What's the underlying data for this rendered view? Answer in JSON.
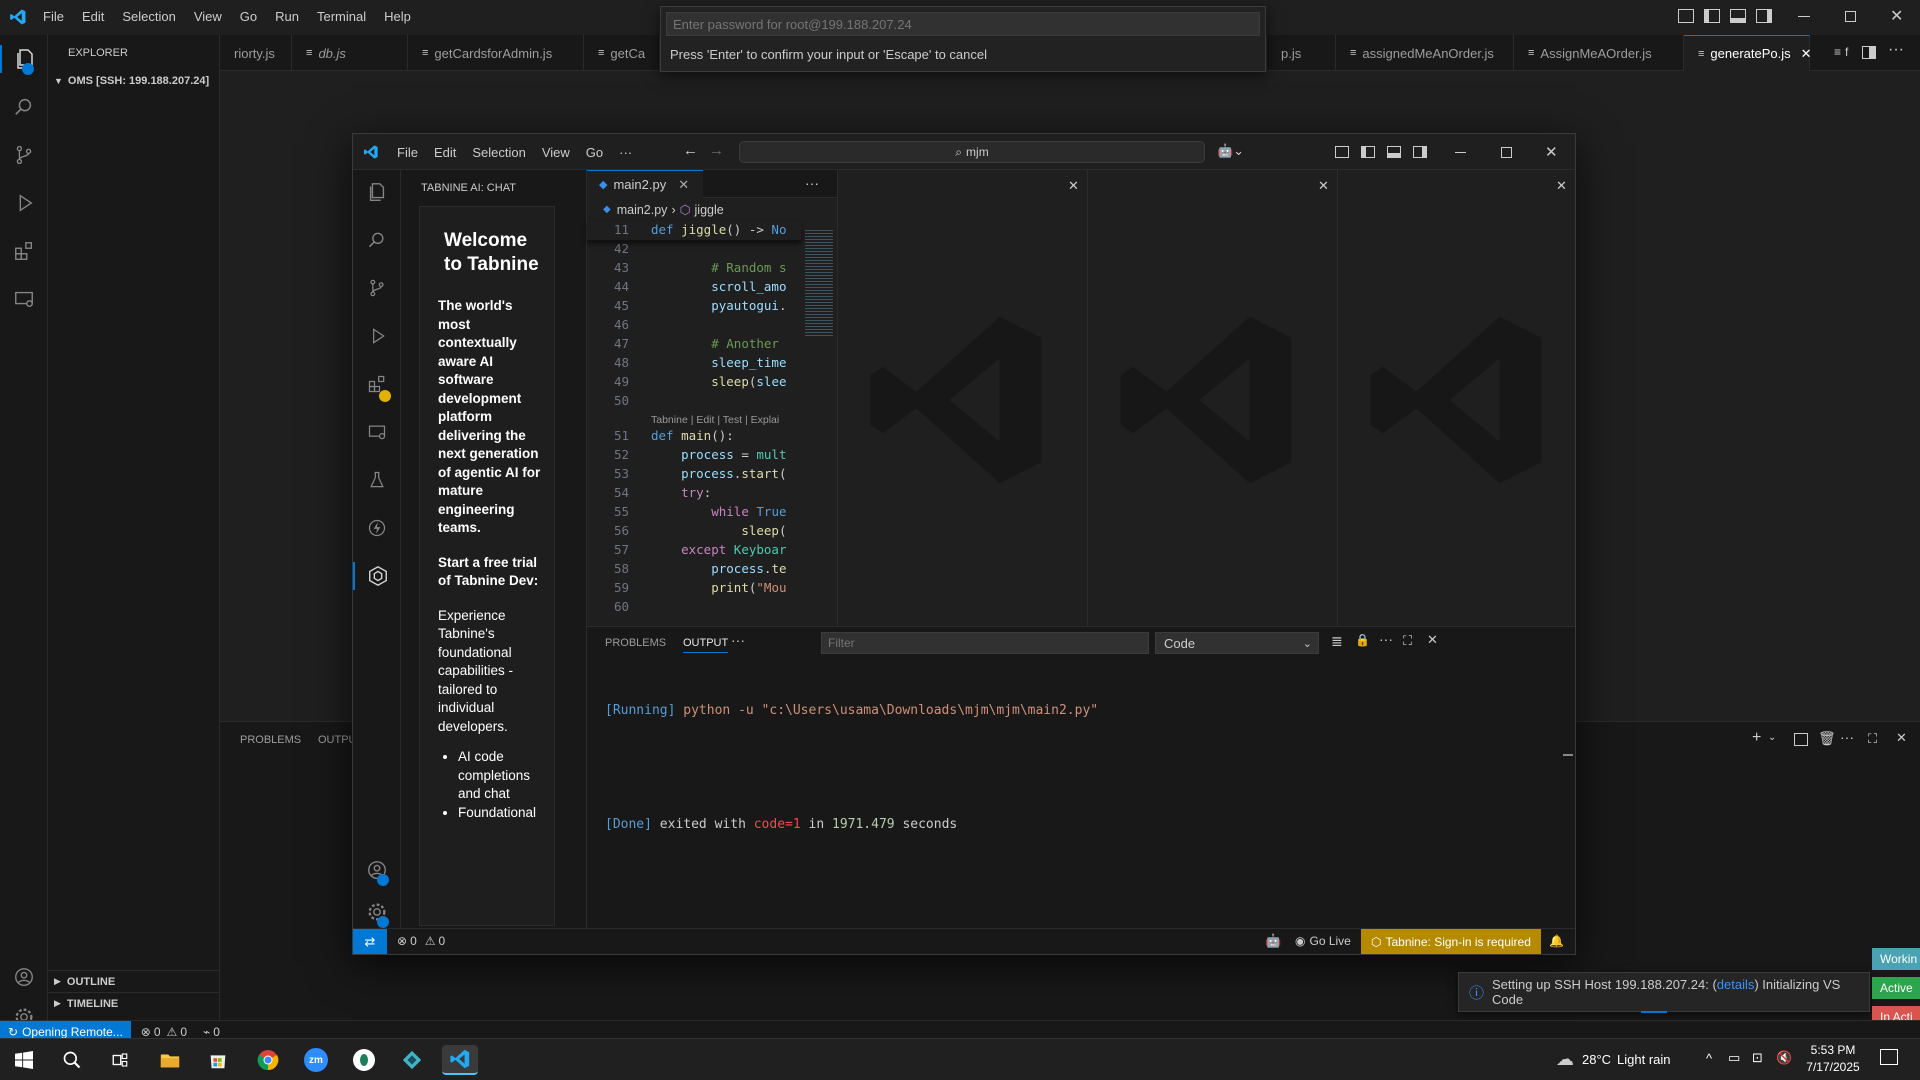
{
  "outer": {
    "menu": [
      "File",
      "Edit",
      "Selection",
      "View",
      "Go",
      "Run",
      "Terminal",
      "Help"
    ],
    "explorer_title": "EXPLORER",
    "folder": "OMS [SSH: 199.188.207.24]",
    "outline": "OUTLINE",
    "timeline": "TIMELINE",
    "tabs": [
      "riorty.js",
      "db.js",
      "getCardsforAdmin.js",
      "getCa",
      "p.js",
      "assignedMeAnOrder.js",
      "AssignMeAOrder.js",
      "generatePo.js"
    ],
    "tab_more": "f",
    "panel_tabs": [
      "PROBLEMS",
      "OUTPU"
    ],
    "status_remote": "Opening Remote...",
    "status_errors": "0",
    "status_warnings": "0",
    "status_ports": "0",
    "password_placeholder": "Enter password for root@199.188.207.24",
    "password_hint": "Press 'Enter' to confirm your input or 'Escape' to cancel",
    "notification": "Setting up SSH Host 199.188.207.24: (details) Initializing VS Code",
    "notif_prefix": "Setting up SSH Host 199.188.207.24: (",
    "notif_link": "details",
    "notif_suffix": ") Initializing VS Code",
    "side_badges": [
      "Workin",
      "Active",
      "In Acti"
    ]
  },
  "inner": {
    "menu": [
      "File",
      "Edit",
      "Selection",
      "View",
      "Go",
      "···"
    ],
    "search": "mjm",
    "sidebar_title": "TABNINE AI: CHAT",
    "tabnine": {
      "welcome": "Welcome to Tabnine",
      "lead": "The world's most contextually aware AI software development platform delivering the next generation of agentic AI for mature engineering teams.",
      "trial": "Start a free trial of Tabnine Dev:",
      "desc": "Experience Tabnine's foundational capabilities - tailored to individual developers.",
      "bullets": [
        "AI code completions and chat",
        "Foundational"
      ]
    },
    "tab": "main2.py",
    "breadcrumb_file": "main2.py",
    "breadcrumb_symbol": "jiggle",
    "codelens": "Tabnine | Edit | Test | Explai",
    "code": [
      {
        "n": "11",
        "html": "<span class='kw'>def</span> <span class='fn'>jiggle</span>() -> <span class='kw'>No</span>"
      },
      {
        "n": "42",
        "html": ""
      },
      {
        "n": "43",
        "html": "        <span class='cm'># Random s</span>"
      },
      {
        "n": "44",
        "html": "        <span class='vr'>scroll_amo</span>"
      },
      {
        "n": "45",
        "html": "        <span class='vr'>pyautogui</span>."
      },
      {
        "n": "46",
        "html": ""
      },
      {
        "n": "47",
        "html": "        <span class='cm'># Another</span>"
      },
      {
        "n": "48",
        "html": "        <span class='vr'>sleep_time</span>"
      },
      {
        "n": "49",
        "html": "        <span class='fn'>sleep</span>(<span class='vr'>slee</span>"
      },
      {
        "n": "50",
        "html": ""
      },
      {
        "n": "51",
        "html": "<span class='kw'>def</span> <span class='fn'>main</span>():"
      },
      {
        "n": "52",
        "html": "    <span class='vr'>process</span> = <span class='cls'>mult</span>"
      },
      {
        "n": "53",
        "html": "    <span class='vr'>process</span>.<span class='fn'>start</span>("
      },
      {
        "n": "54",
        "html": "    <span class='kw2'>try</span>:"
      },
      {
        "n": "55",
        "html": "        <span class='kw2'>while</span> <span class='kw'>True</span>"
      },
      {
        "n": "56",
        "html": "            <span class='fn'>sleep</span>("
      },
      {
        "n": "57",
        "html": "    <span class='kw2'>except</span> <span class='cls'>Keyboar</span>"
      },
      {
        "n": "58",
        "html": "        <span class='vr'>process</span>.<span class='fn'>te</span>"
      },
      {
        "n": "59",
        "html": "        <span class='fn'>print</span>(<span class='str'>\"Mou</span>"
      },
      {
        "n": "60",
        "html": ""
      }
    ],
    "panel_tabs": [
      "PROBLEMS",
      "OUTPUT"
    ],
    "filter_placeholder": "Filter",
    "output_channel": "Code",
    "output": {
      "running_tag": "[Running]",
      "running_cmd": "python -u \"c:\\Users\\usama\\Downloads\\mjm\\mjm\\main2.py\"",
      "done_tag": "[Done]",
      "done_pre": "exited with",
      "done_code": "code=1",
      "done_in": "in",
      "done_secs": "1971.479",
      "done_unit": "seconds"
    },
    "status_errors": "0",
    "status_warnings": "0",
    "go_live": "Go Live",
    "tabnine_status": "Tabnine: Sign-in is required"
  },
  "taskbar": {
    "weather_temp": "28°C",
    "weather_text": "Light rain",
    "time": "5:53 PM",
    "date": "7/17/2025"
  },
  "colors": {
    "accent": "#0078d4",
    "status_warning_bg": "#b68a00",
    "remote_bg": "#0078d4"
  }
}
